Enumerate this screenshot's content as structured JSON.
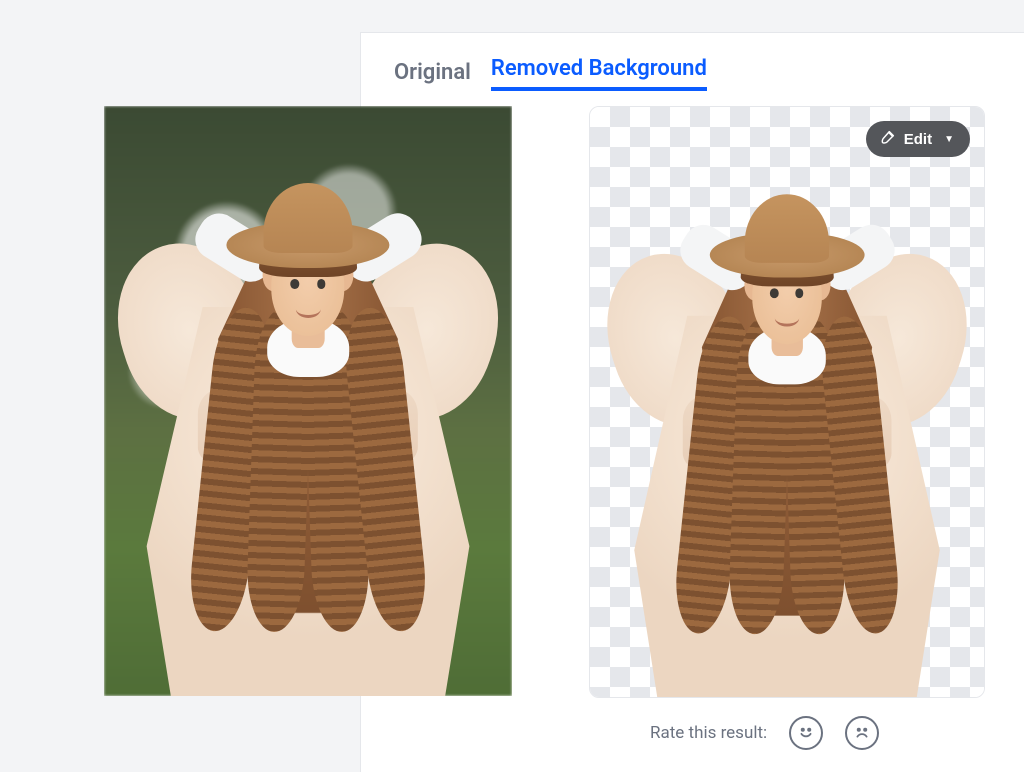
{
  "tabs": {
    "original": "Original",
    "removed": "Removed Background"
  },
  "edit_button": {
    "label": "Edit"
  },
  "rating": {
    "prompt": "Rate this result:"
  }
}
